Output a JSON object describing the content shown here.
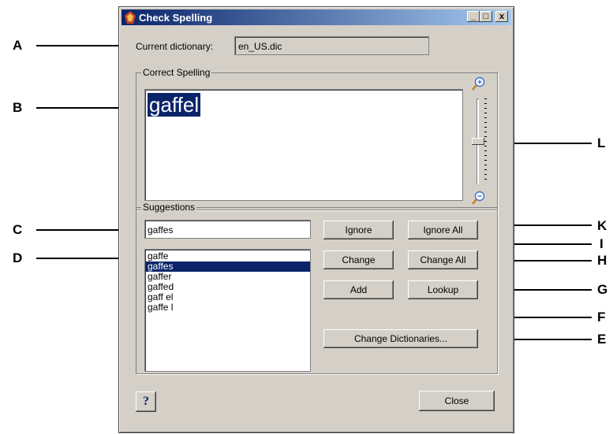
{
  "window": {
    "title": "Check Spelling",
    "minimize": "_",
    "maximize": "□",
    "close": "x"
  },
  "dictionary": {
    "label": "Current dictionary:",
    "value": "en_US.dic"
  },
  "correct_spelling": {
    "label": "Correct Spelling",
    "word": "gaffel",
    "zoom_level": 0.5
  },
  "suggestions": {
    "label": "Suggestions",
    "input_value": "gaffes",
    "items": [
      "gaffe",
      "gaffes",
      "gaffer",
      "gaffed",
      "gaff el",
      "gaffe l"
    ],
    "selected": "gaffes"
  },
  "buttons": {
    "ignore": "Ignore",
    "ignore_all": "Ignore All",
    "change": "Change",
    "change_all": "Change All",
    "add": "Add",
    "lookup": "Lookup",
    "change_dictionaries": "Change Dictionaries...",
    "help": "?",
    "close": "Close"
  },
  "callouts": {
    "a": "A",
    "b": "B",
    "c": "C",
    "d": "D",
    "e": "E",
    "f": "F",
    "g": "G",
    "h": "H",
    "i": "I",
    "k": "K",
    "l": "L"
  },
  "colors": {
    "title_bar": "#0a246a",
    "selection": "#0a246a",
    "dialog_bg": "#d4d0c8"
  }
}
